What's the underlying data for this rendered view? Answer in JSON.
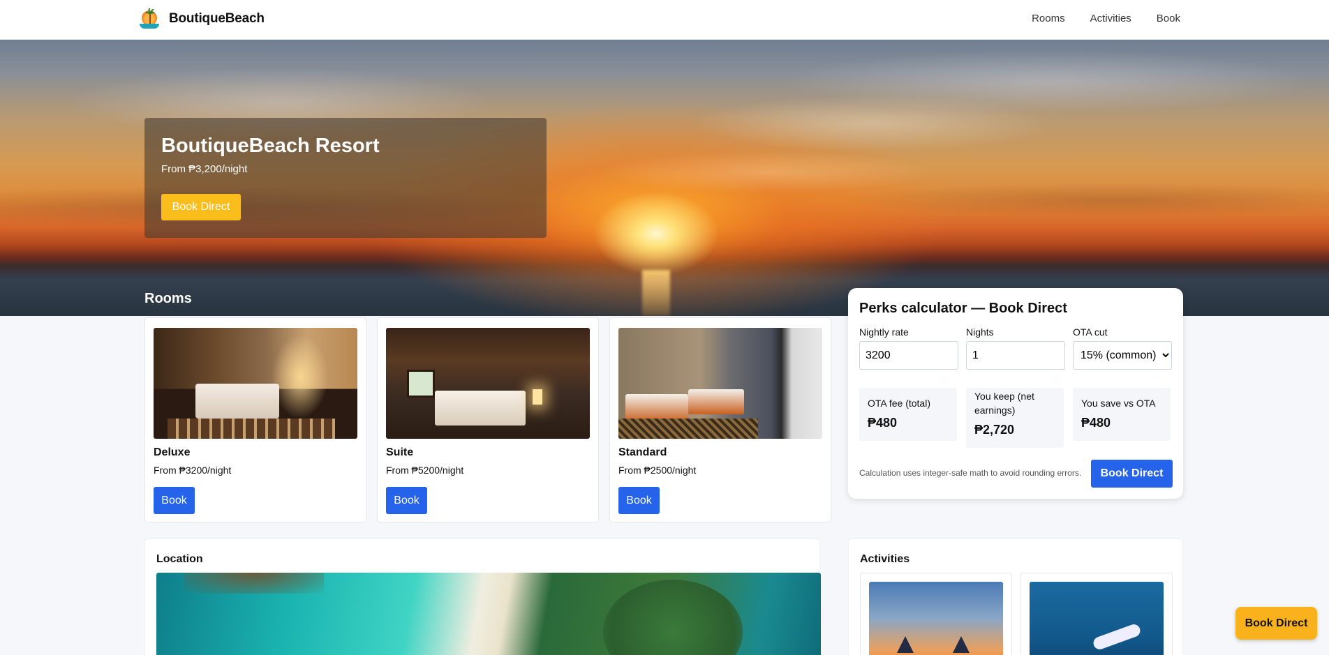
{
  "header": {
    "brand": "BoutiqueBeach",
    "nav": [
      "Rooms",
      "Activities",
      "Book"
    ]
  },
  "hero": {
    "title": "BoutiqueBeach Resort",
    "subtitle": "From ₱3,200/night",
    "cta": "Book Direct"
  },
  "rooms": {
    "title": "Rooms",
    "items": [
      {
        "name": "Deluxe",
        "price": "From ₱3200/night",
        "button": "Book"
      },
      {
        "name": "Suite",
        "price": "From ₱5200/night",
        "button": "Book"
      },
      {
        "name": "Standard",
        "price": "From ₱2500/night",
        "button": "Book"
      }
    ]
  },
  "perks": {
    "title": "Perks calculator — Book Direct",
    "nightly_label": "Nightly rate",
    "nightly_value": "3200",
    "nights_label": "Nights",
    "nights_value": "1",
    "ota_label": "OTA cut",
    "ota_selected": "15% (common)",
    "stats": [
      {
        "label": "OTA fee (total)",
        "value": "₱480"
      },
      {
        "label": "You keep (net earnings)",
        "value": "₱2,720"
      },
      {
        "label": "You save vs OTA",
        "value": "₱480"
      }
    ],
    "note": "Calculation uses integer-safe math to avoid rounding errors.",
    "cta": "Book Direct"
  },
  "location": {
    "title": "Location"
  },
  "activities": {
    "title": "Activities"
  },
  "floating_cta": "Book Direct",
  "colors": {
    "accent_blue": "#2563eb",
    "accent_yellow": "#f9bd1c"
  }
}
